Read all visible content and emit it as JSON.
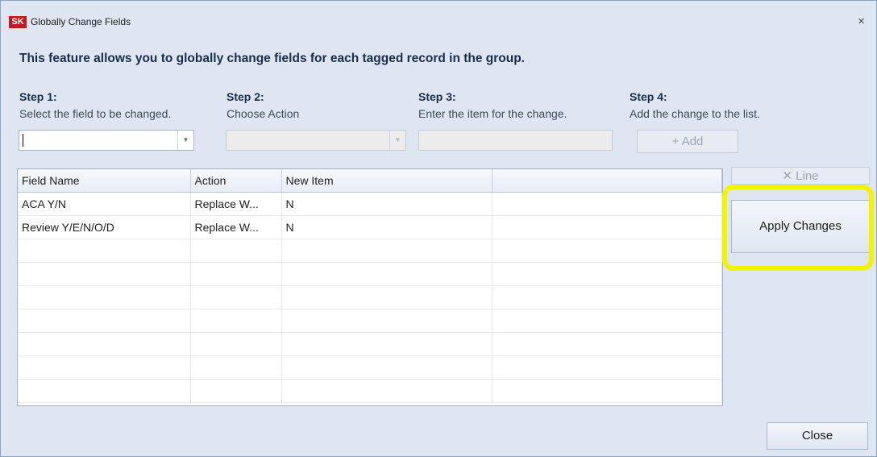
{
  "window": {
    "title": "Globally Change Fields",
    "app_icon_text": "SK",
    "close_glyph": "✕"
  },
  "headline": "This feature allows you to globally change fields for each tagged record in the group.",
  "steps": [
    {
      "title": "Step 1:",
      "desc": "Select the field to be changed."
    },
    {
      "title": "Step 2:",
      "desc": "Choose Action"
    },
    {
      "title": "Step 3:",
      "desc": "Enter the item for the change."
    },
    {
      "title": "Step 4:",
      "desc": "Add the change to the list."
    }
  ],
  "inputs": {
    "field_select_value": "",
    "action_select_value": "",
    "item_value": ""
  },
  "buttons": {
    "add": "+ Add",
    "delete_line": "✕ Line",
    "apply": "Apply Changes",
    "close": "Close"
  },
  "grid": {
    "columns": [
      "Field Name",
      "Action",
      "New Item",
      ""
    ],
    "rows": [
      [
        "ACA Y/N",
        "Replace W...",
        "N",
        ""
      ],
      [
        "Review Y/E/N/O/D",
        "Replace W...",
        "N",
        ""
      ],
      [
        "",
        "",
        "",
        ""
      ],
      [
        "",
        "",
        "",
        ""
      ],
      [
        "",
        "",
        "",
        ""
      ],
      [
        "",
        "",
        "",
        ""
      ],
      [
        "",
        "",
        "",
        ""
      ],
      [
        "",
        "",
        "",
        ""
      ],
      [
        "",
        "",
        "",
        ""
      ]
    ]
  },
  "colors": {
    "highlight": "#f4f400",
    "app_icon": "#c21a22",
    "window_bg": "#dde6f1"
  }
}
